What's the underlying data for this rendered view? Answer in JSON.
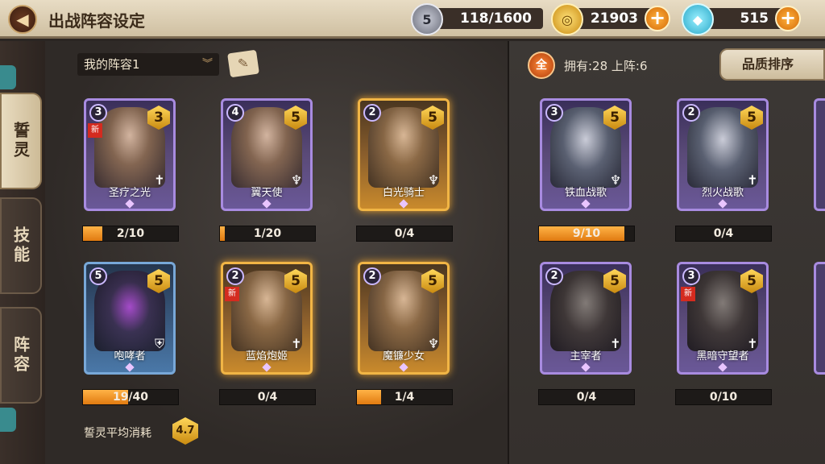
{
  "header": {
    "title": "出战阵容设定",
    "stamina": {
      "level": "5",
      "value": "118/1600"
    },
    "gold": {
      "value": "21903"
    },
    "gem": {
      "value": "515"
    }
  },
  "sidebar": {
    "tabs": [
      {
        "label": "誓灵",
        "active": true
      },
      {
        "label": "技能",
        "active": false
      },
      {
        "label": "阵容",
        "active": false
      }
    ]
  },
  "lineup": {
    "selected": "我的阵容1",
    "avg_label": "誓灵平均消耗",
    "avg_value": "4.7",
    "cards": [
      {
        "name": "圣疗之光",
        "level": "3",
        "cost": "3",
        "new": true,
        "progress": "2/10",
        "fill": 0.2,
        "frame": "purple",
        "art": "",
        "class_glyph": "✝"
      },
      {
        "name": "翼天使",
        "level": "4",
        "cost": "5",
        "new": false,
        "progress": "1/20",
        "fill": 0.05,
        "frame": "purple",
        "art": "",
        "class_glyph": "♆"
      },
      {
        "name": "白光骑士",
        "level": "2",
        "cost": "5",
        "new": false,
        "progress": "0/4",
        "fill": 0,
        "frame": "orange",
        "art": "",
        "class_glyph": "♆"
      },
      {
        "name": "咆哮者",
        "level": "5",
        "cost": "5",
        "new": false,
        "progress": "19/40",
        "fill": 0.475,
        "frame": "blue",
        "art": "",
        "class_glyph": "⛨"
      },
      {
        "name": "蓝焰炮姬",
        "level": "2",
        "cost": "5",
        "new": true,
        "progress": "0/4",
        "fill": 0,
        "frame": "orange",
        "art": "",
        "class_glyph": "✝"
      },
      {
        "name": "魔镰少女",
        "level": "2",
        "cost": "5",
        "new": false,
        "progress": "1/4",
        "fill": 0.25,
        "frame": "orange",
        "art": "",
        "class_glyph": "♆"
      }
    ]
  },
  "collection": {
    "all_label": "全",
    "owned_text": "拥有:28  上阵:6",
    "sort_label": "品质排序",
    "cards": [
      {
        "name": "铁血战歌",
        "level": "3",
        "cost": "5",
        "new": false,
        "progress": "9/10",
        "fill": 0.9,
        "frame": "purple",
        "art": "mech",
        "class_glyph": "♆"
      },
      {
        "name": "烈火战歌",
        "level": "2",
        "cost": "5",
        "new": false,
        "progress": "0/4",
        "fill": 0,
        "frame": "purple",
        "art": "mech",
        "class_glyph": "✝"
      },
      {
        "name": "主宰者",
        "level": "2",
        "cost": "5",
        "new": false,
        "progress": "0/4",
        "fill": 0,
        "frame": "purple",
        "art": "dark",
        "class_glyph": "✝"
      },
      {
        "name": "黑暗守望者",
        "level": "3",
        "cost": "5",
        "new": true,
        "progress": "0/10",
        "fill": 0,
        "frame": "purple",
        "art": "dark",
        "class_glyph": "✝"
      }
    ]
  }
}
